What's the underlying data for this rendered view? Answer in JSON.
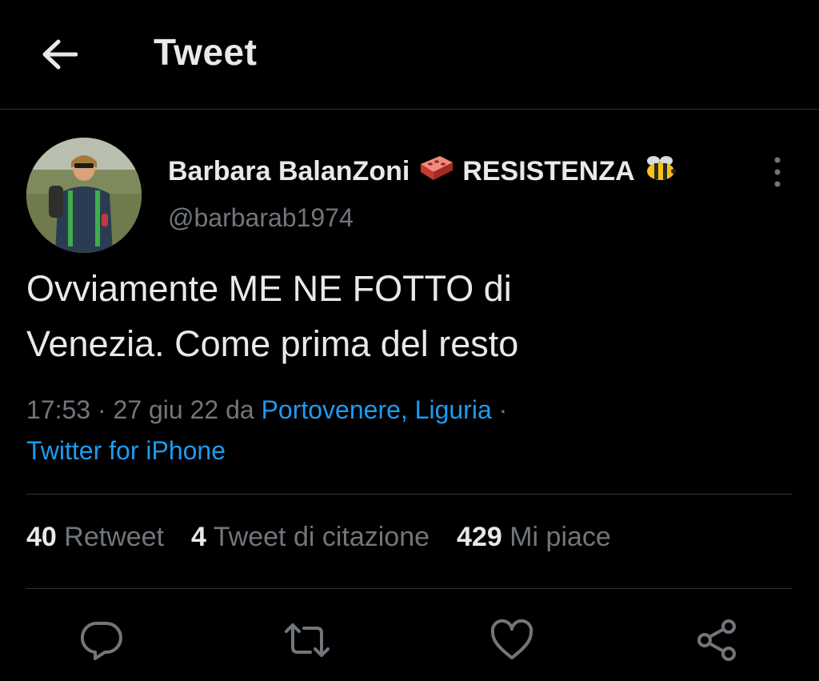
{
  "header": {
    "title": "Tweet",
    "back_icon": "arrow-left-icon"
  },
  "tweet": {
    "author_name": "Barbara BalanZoni",
    "author_suffix": "RESISTENZA",
    "author_emojis": [
      "brick-icon",
      "bee-icon"
    ],
    "handle": "@barbarab1974",
    "text_line1": "Ovviamente ME NE FOTTO di",
    "text_line2": "Venezia. Come prima del resto",
    "time": "17:53",
    "sep": "·",
    "date": "27 giu 22",
    "from_word": "da",
    "location": "Portovenere, Liguria",
    "client": "Twitter for iPhone"
  },
  "stats": {
    "retweets_count": "40",
    "retweets_label": "Retweet",
    "quotes_count": "4",
    "quotes_label": "Tweet di citazione",
    "likes_count": "429",
    "likes_label": "Mi piace"
  },
  "actions": [
    "reply-icon",
    "retweet-icon",
    "like-icon",
    "share-icon"
  ],
  "colors": {
    "background": "#000000",
    "text": "#e7e9ea",
    "muted": "#71767b",
    "link": "#1d9bf0",
    "divider": "#2f3336"
  }
}
